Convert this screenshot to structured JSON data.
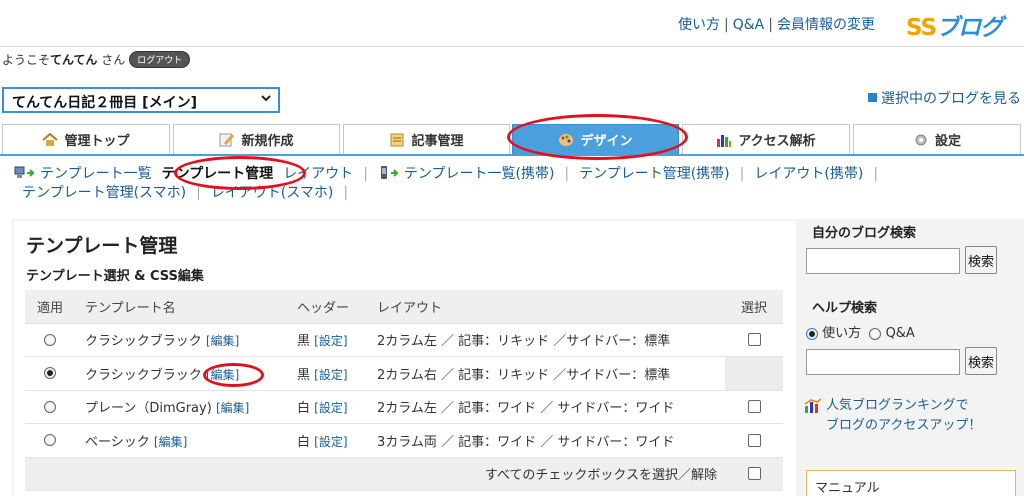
{
  "header": {
    "links": [
      "使い方",
      "Q&A",
      "会員情報の変更"
    ],
    "logo_ss": "SS",
    "logo_blog": "ブログ"
  },
  "welcome": {
    "prefix": "ようこそ",
    "user": "てんてん",
    "suffix": "さん",
    "logout": "ログアウト"
  },
  "blog_select": {
    "value": "てんてん日記２冊目 [メイン]"
  },
  "view_blog": "選択中のブログを見る",
  "tabs": [
    {
      "label": "管理トップ",
      "icon": "home-icon"
    },
    {
      "label": "新規作成",
      "icon": "pencil-icon"
    },
    {
      "label": "記事管理",
      "icon": "document-icon"
    },
    {
      "label": "デザイン",
      "icon": "palette-icon",
      "active": true
    },
    {
      "label": "アクセス解析",
      "icon": "bar-chart-icon"
    },
    {
      "label": "設定",
      "icon": "gear-icon"
    }
  ],
  "subnav": {
    "pc_items": [
      "テンプレート一覧",
      "テンプレート管理",
      "レイアウト"
    ],
    "mobile_items": [
      "テンプレート一覧(携帯)",
      "テンプレート管理(携帯)",
      "レイアウト(携帯)"
    ],
    "smart_items": [
      "テンプレート管理(スマホ)",
      "レイアウト(スマホ)"
    ]
  },
  "main": {
    "title": "テンプレート管理",
    "subtitle": "テンプレート選択 & CSS編集",
    "table": {
      "headers": [
        "適用",
        "テンプレート名",
        "ヘッダー",
        "レイアウト",
        "選択"
      ],
      "rows": [
        {
          "applied": false,
          "name": "クラシックブラック",
          "edit": "[編集]",
          "header": "黒",
          "setting": "[設定]",
          "layout": "2カラム左 ／ 記事：リキッド ／サイドバー：標準",
          "has_checkbox": true
        },
        {
          "applied": true,
          "name": "クラシックブラック",
          "edit": "[編集]",
          "header": "黒",
          "setting": "[設定]",
          "layout": "2カラム右 ／ 記事：リキッド ／サイドバー：標準",
          "has_checkbox": false
        },
        {
          "applied": false,
          "name": "プレーン（DimGray)",
          "edit": "[編集]",
          "header": "白",
          "setting": "[設定]",
          "layout": "2カラム左 ／ 記事：ワイド ／ サイドバー：ワイド",
          "has_checkbox": true
        },
        {
          "applied": false,
          "name": "ベーシック",
          "edit": "[編集]",
          "header": "白",
          "setting": "[設定]",
          "layout": "3カラム両 ／ 記事：ワイド ／ サイドバー：ワイド",
          "has_checkbox": true
        }
      ],
      "footer": "すべてのチェックボックスを選択／解除"
    }
  },
  "sidebar": {
    "blog_search_title": "自分のブログ検索",
    "search_button": "検索",
    "help_search_title": "ヘルプ検索",
    "help_options": [
      "使い方",
      "Q&A"
    ],
    "help_selected": 0,
    "ranking_line1": "人気ブログランキングで",
    "ranking_line2": "ブログのアクセスアップ！",
    "manual": "マニュアル"
  },
  "colors": {
    "accent": "#4a9fdc",
    "link": "#1a5d95",
    "annotation": "#e2101e",
    "logo_orange": "#f5a100"
  }
}
